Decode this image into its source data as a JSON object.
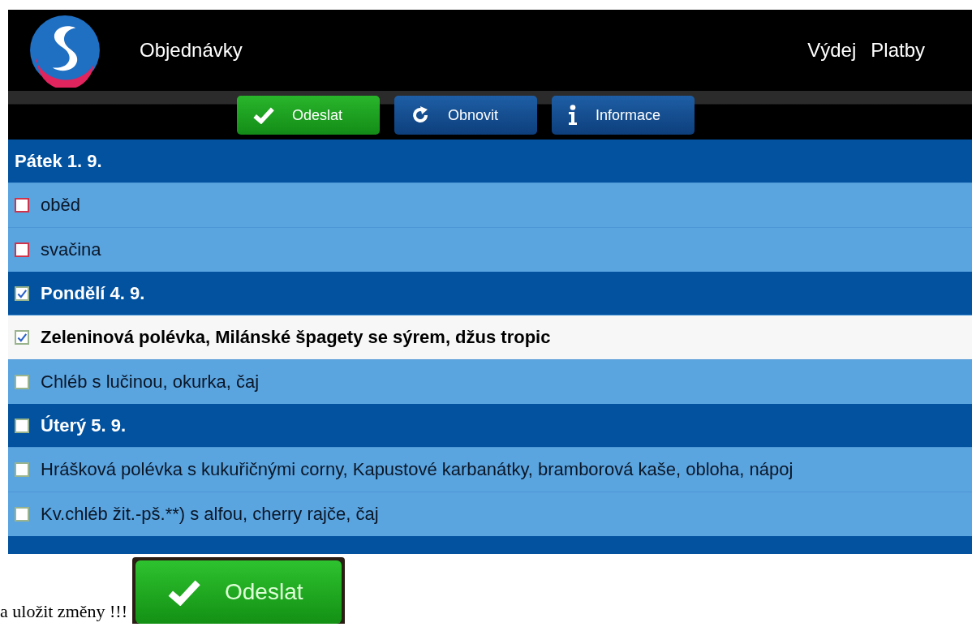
{
  "header": {
    "title": "Objednávky",
    "nav": [
      {
        "label": "Výdej"
      },
      {
        "label": "Platby"
      }
    ]
  },
  "toolbar": [
    {
      "label": "Odeslat",
      "kind": "send"
    },
    {
      "label": "Obnovit",
      "kind": "refresh"
    },
    {
      "label": "Informace",
      "kind": "info"
    }
  ],
  "days": [
    {
      "label": "Pátek 1. 9.",
      "kind": "plain",
      "items": [
        {
          "label": "oběd",
          "checked": false,
          "locked": true,
          "selected": false
        },
        {
          "label": "svačina",
          "checked": false,
          "locked": true,
          "selected": false
        }
      ]
    },
    {
      "label": "Pondělí 4. 9.",
      "kind": "checkable",
      "checked": true,
      "items": [
        {
          "label": "Zeleninová polévka, Milánské špagety se sýrem, džus tropic",
          "checked": true,
          "locked": false,
          "selected": true
        },
        {
          "label": "Chléb s lučinou, okurka, čaj",
          "checked": false,
          "locked": false,
          "selected": false
        }
      ]
    },
    {
      "label": "Úterý 5. 9.",
      "kind": "checkable",
      "checked": false,
      "items": [
        {
          "label": "Hrášková polévka s kukuřičnými corny, Kapustové karbanátky, bramborová kaše, obloha, nápoj",
          "checked": false,
          "locked": false,
          "selected": false
        },
        {
          "label": "Kv.chléb žit.-pš.**) s alfou, cherry rajče, čaj",
          "checked": false,
          "locked": false,
          "selected": false
        }
      ]
    }
  ],
  "footer": {
    "text": "a uložit změny !!!",
    "button": {
      "label": "Odeslat"
    }
  }
}
